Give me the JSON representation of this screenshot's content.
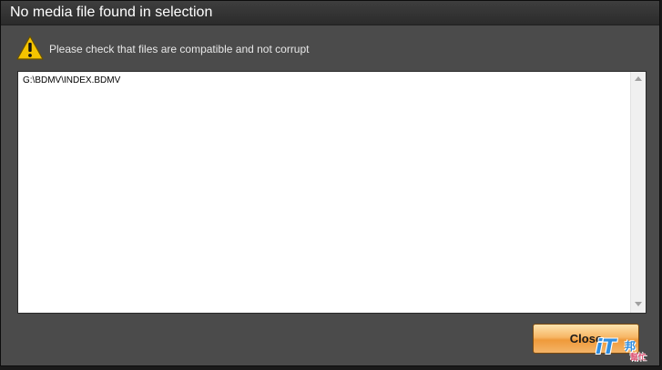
{
  "dialog": {
    "title": "No media file found in selection",
    "message": "Please check that files are compatible and not corrupt",
    "warning_icon": "warning-triangle-icon"
  },
  "file_list": {
    "items": [
      "G:\\BDMV\\INDEX.BDMV"
    ]
  },
  "buttons": {
    "close_label": "Close"
  },
  "watermark": {
    "brand": "iT",
    "chars": "邦",
    "sub": "幫忙"
  },
  "colors": {
    "dialog_bg": "#4b4b4b",
    "titlebar_bg": "#2b2b2b",
    "button_accent": "#f7b665",
    "warning_yellow": "#f5c400"
  }
}
